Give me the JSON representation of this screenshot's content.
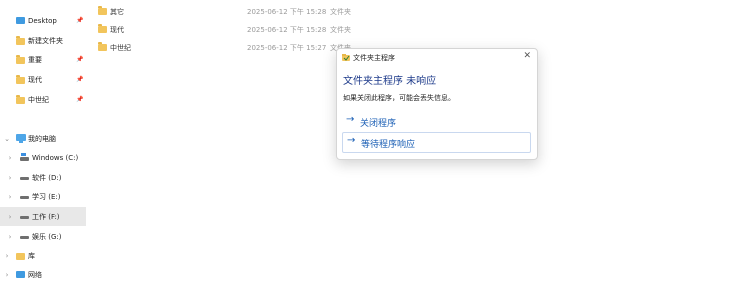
{
  "sidebar": {
    "quick_access": [
      {
        "label": "Desktop",
        "icon": "desktop-icon",
        "pinned": true
      },
      {
        "label": "新建文件夹",
        "icon": "folder-icon",
        "pinned": false
      },
      {
        "label": "重要",
        "icon": "folder-icon",
        "pinned": true
      },
      {
        "label": "现代",
        "icon": "folder-icon",
        "pinned": true
      },
      {
        "label": "中世纪",
        "icon": "folder-icon",
        "pinned": true
      }
    ],
    "this_pc": {
      "label": "我的电脑",
      "icon": "computer-icon",
      "expanded": true
    },
    "drives": [
      {
        "label": "Windows (C:)",
        "icon": "windows-drive-icon"
      },
      {
        "label": "软件 (D:)",
        "icon": "drive-icon"
      },
      {
        "label": "学习 (E:)",
        "icon": "drive-icon"
      },
      {
        "label": "工作 (F:)",
        "icon": "drive-icon",
        "selected": true
      },
      {
        "label": "娱乐 (G:)",
        "icon": "drive-icon"
      }
    ],
    "library": {
      "label": "库",
      "icon": "library-icon"
    },
    "network": {
      "label": "网络",
      "icon": "network-icon"
    }
  },
  "files": [
    {
      "name": "其它",
      "modified": "2025-06-12 下午 15:28",
      "type": "文件夹"
    },
    {
      "name": "现代",
      "modified": "2025-06-12 下午 15:28",
      "type": "文件夹"
    },
    {
      "name": "中世纪",
      "modified": "2025-06-12 下午 15:27",
      "type": "文件夹"
    }
  ],
  "dialog": {
    "title": "文件夹主程序",
    "close_symbol": "✕",
    "heading": "文件夹主程序 未响应",
    "message": "如果关闭此程序，可能会丢失信息。",
    "options": [
      {
        "arrow": "→",
        "label": "关闭程序"
      },
      {
        "arrow": "→",
        "label": "等待程序响应",
        "focused": true
      }
    ]
  },
  "colors": {
    "accent": "#1b5fb5",
    "heading": "#1d3a8a",
    "folder": "#f2c55c",
    "selection": "#e8e8e8"
  }
}
